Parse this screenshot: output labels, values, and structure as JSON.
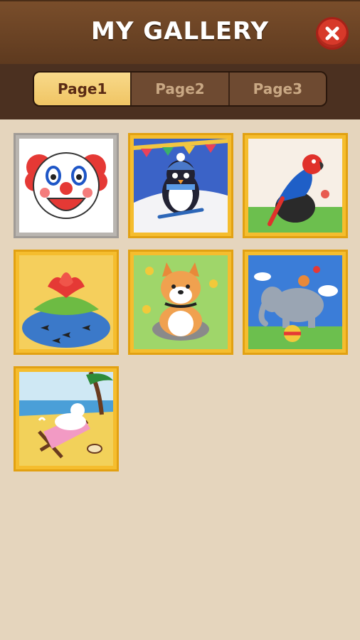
{
  "header": {
    "title": "MY GALLERY",
    "close_icon": "close-icon"
  },
  "tabs": [
    {
      "label": "Page1",
      "active": true
    },
    {
      "label": "Page2",
      "active": false
    },
    {
      "label": "Page3",
      "active": false
    }
  ],
  "gallery": [
    {
      "subject": "clown"
    },
    {
      "subject": "penguin"
    },
    {
      "subject": "parrot"
    },
    {
      "subject": "lotus"
    },
    {
      "subject": "shiba"
    },
    {
      "subject": "elephant"
    },
    {
      "subject": "cat-beach"
    }
  ]
}
